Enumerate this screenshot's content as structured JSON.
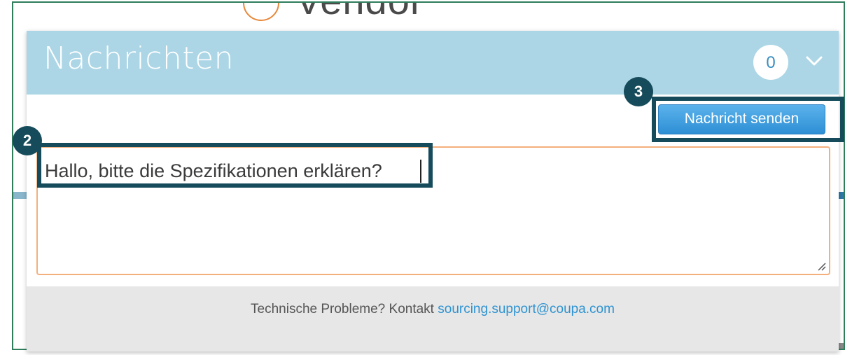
{
  "background": {
    "logo_text": "Vendor"
  },
  "messages_panel": {
    "title": "Nachrichten",
    "unread_count": "0",
    "send_button_label": "Nachricht senden",
    "message_value": "Hallo, bitte die Spezifikationen erklären?",
    "footer": {
      "prefix": "Technische Probleme? Kontakt",
      "support_email": "sourcing.support@coupa.com"
    }
  },
  "annotations": {
    "step_text_field": "2",
    "step_send_button": "3",
    "highlight_color": "#154b5a"
  },
  "colors": {
    "header_bg": "#acd6e6",
    "button_blue": "#2e8fd4",
    "input_border": "#f4b07c",
    "link": "#2e93d1"
  }
}
